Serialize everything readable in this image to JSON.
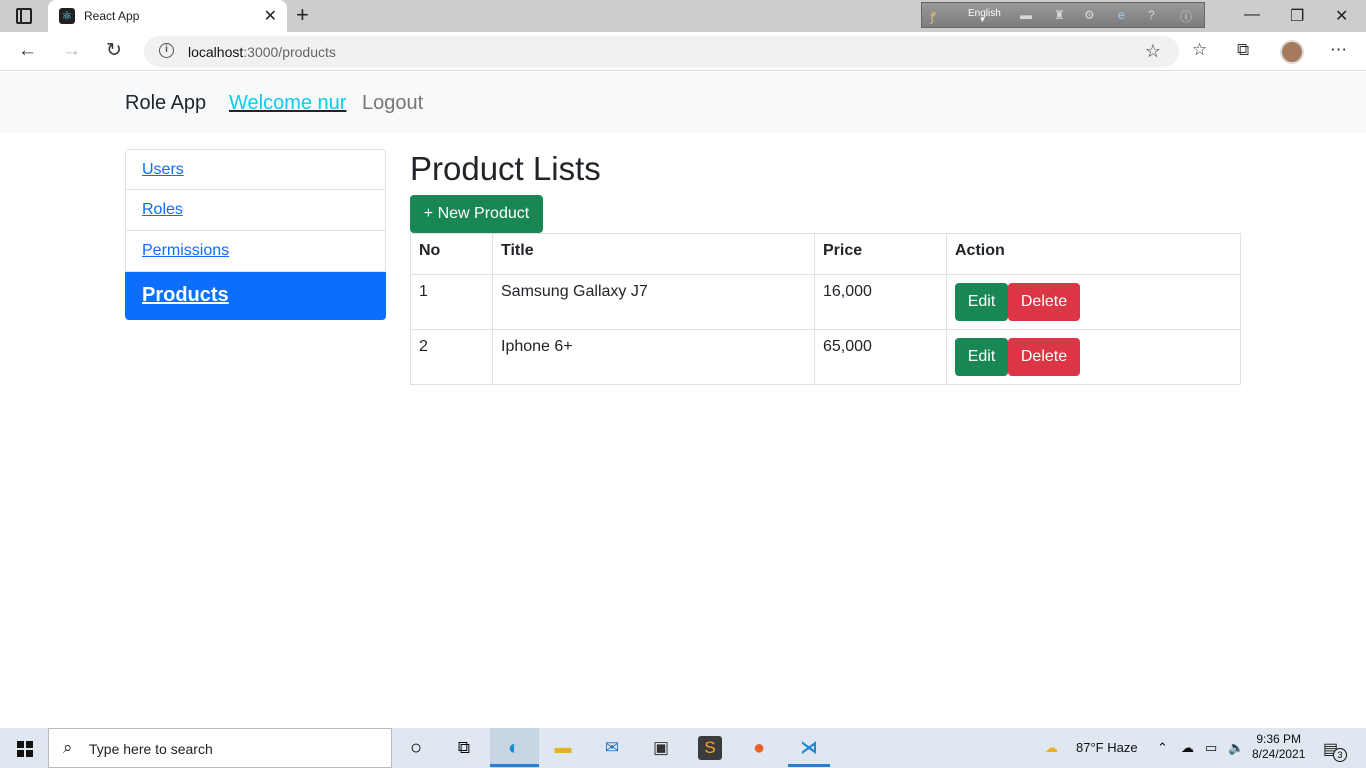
{
  "browser": {
    "tab_title": "React App",
    "url_host": "localhost",
    "url_path": ":3000/products",
    "ime_language": "English"
  },
  "navbar": {
    "brand": "Role App",
    "welcome": "Welcome nur",
    "logout": "Logout"
  },
  "sidebar": {
    "items": [
      {
        "label": "Users"
      },
      {
        "label": "Roles"
      },
      {
        "label": "Permissions"
      },
      {
        "label": "Products",
        "active": true
      }
    ]
  },
  "main": {
    "title": "Product Lists",
    "new_button": "+ New Product",
    "table": {
      "headers": [
        "No",
        "Title",
        "Price",
        "Action"
      ],
      "rows": [
        {
          "no": "1",
          "title": "Samsung Gallaxy J7",
          "price": "16,000"
        },
        {
          "no": "2",
          "title": "Iphone 6+",
          "price": "65,000"
        }
      ],
      "edit_label": "Edit",
      "delete_label": "Delete"
    }
  },
  "taskbar": {
    "search_placeholder": "Type here to search",
    "weather": "87°F  Haze",
    "time": "9:36 PM",
    "date": "8/24/2021",
    "notifications": "3"
  },
  "colors": {
    "primary": "#0d6efd",
    "success": "#198754",
    "danger": "#dc3545",
    "info": "#0dcaf0"
  }
}
